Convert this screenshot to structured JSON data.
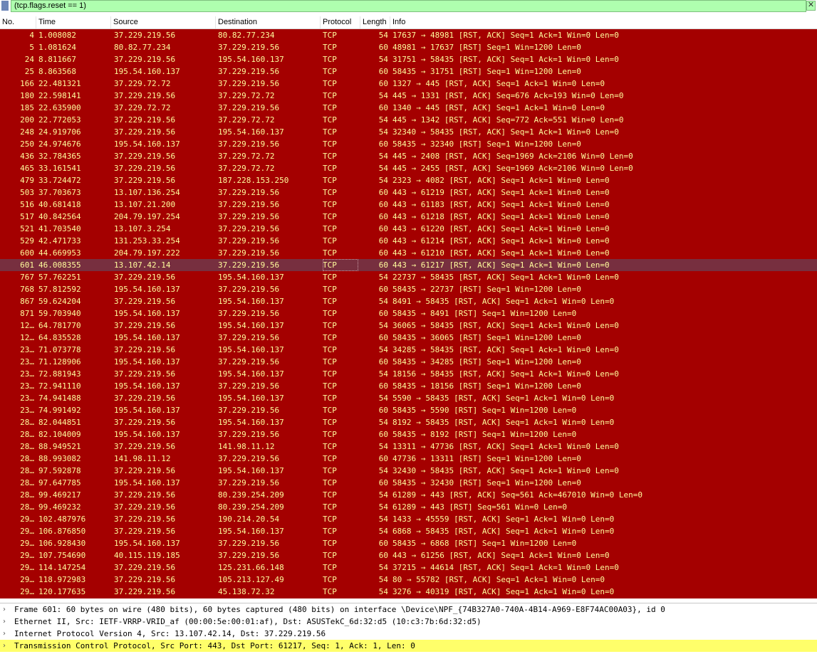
{
  "filter": {
    "value": "(tcp.flags.reset == 1)",
    "close_glyph": "✕"
  },
  "columns": [
    "No.",
    "Time",
    "Source",
    "Destination",
    "Protocol",
    "Length",
    "Info"
  ],
  "colors": {
    "row_bg": "#a40000",
    "row_fg": "#fffc9c",
    "selected_bg": "#772f3f",
    "filter_bg": "#afffaf",
    "highlight_bg": "#ffff6a"
  },
  "selected_no": "601",
  "packets": [
    {
      "no": "4",
      "time": "1.008082",
      "src": "37.229.219.56",
      "dst": "80.82.77.234",
      "proto": "TCP",
      "len": "54",
      "info": "17637 → 48981 [RST, ACK] Seq=1 Ack=1 Win=0 Len=0"
    },
    {
      "no": "5",
      "time": "1.081624",
      "src": "80.82.77.234",
      "dst": "37.229.219.56",
      "proto": "TCP",
      "len": "60",
      "info": "48981 → 17637 [RST] Seq=1 Win=1200 Len=0"
    },
    {
      "no": "24",
      "time": "8.811667",
      "src": "37.229.219.56",
      "dst": "195.54.160.137",
      "proto": "TCP",
      "len": "54",
      "info": "31751 → 58435 [RST, ACK] Seq=1 Ack=1 Win=0 Len=0"
    },
    {
      "no": "25",
      "time": "8.863568",
      "src": "195.54.160.137",
      "dst": "37.229.219.56",
      "proto": "TCP",
      "len": "60",
      "info": "58435 → 31751 [RST] Seq=1 Win=1200 Len=0"
    },
    {
      "no": "166",
      "time": "22.481321",
      "src": "37.229.72.72",
      "dst": "37.229.219.56",
      "proto": "TCP",
      "len": "60",
      "info": "1327 → 445 [RST, ACK] Seq=1 Ack=1 Win=0 Len=0"
    },
    {
      "no": "180",
      "time": "22.598141",
      "src": "37.229.219.56",
      "dst": "37.229.72.72",
      "proto": "TCP",
      "len": "54",
      "info": "445 → 1331 [RST, ACK] Seq=676 Ack=193 Win=0 Len=0"
    },
    {
      "no": "185",
      "time": "22.635900",
      "src": "37.229.72.72",
      "dst": "37.229.219.56",
      "proto": "TCP",
      "len": "60",
      "info": "1340 → 445 [RST, ACK] Seq=1 Ack=1 Win=0 Len=0"
    },
    {
      "no": "200",
      "time": "22.772053",
      "src": "37.229.219.56",
      "dst": "37.229.72.72",
      "proto": "TCP",
      "len": "54",
      "info": "445 → 1342 [RST, ACK] Seq=772 Ack=551 Win=0 Len=0"
    },
    {
      "no": "248",
      "time": "24.919706",
      "src": "37.229.219.56",
      "dst": "195.54.160.137",
      "proto": "TCP",
      "len": "54",
      "info": "32340 → 58435 [RST, ACK] Seq=1 Ack=1 Win=0 Len=0"
    },
    {
      "no": "250",
      "time": "24.974676",
      "src": "195.54.160.137",
      "dst": "37.229.219.56",
      "proto": "TCP",
      "len": "60",
      "info": "58435 → 32340 [RST] Seq=1 Win=1200 Len=0"
    },
    {
      "no": "436",
      "time": "32.784365",
      "src": "37.229.219.56",
      "dst": "37.229.72.72",
      "proto": "TCP",
      "len": "54",
      "info": "445 → 2408 [RST, ACK] Seq=1969 Ack=2106 Win=0 Len=0"
    },
    {
      "no": "465",
      "time": "33.161541",
      "src": "37.229.219.56",
      "dst": "37.229.72.72",
      "proto": "TCP",
      "len": "54",
      "info": "445 → 2455 [RST, ACK] Seq=1969 Ack=2106 Win=0 Len=0"
    },
    {
      "no": "479",
      "time": "33.724472",
      "src": "37.229.219.56",
      "dst": "187.228.153.250",
      "proto": "TCP",
      "len": "54",
      "info": "2323 → 4082 [RST, ACK] Seq=1 Ack=1 Win=0 Len=0"
    },
    {
      "no": "503",
      "time": "37.703673",
      "src": "13.107.136.254",
      "dst": "37.229.219.56",
      "proto": "TCP",
      "len": "60",
      "info": "443 → 61219 [RST, ACK] Seq=1 Ack=1 Win=0 Len=0"
    },
    {
      "no": "516",
      "time": "40.681418",
      "src": "13.107.21.200",
      "dst": "37.229.219.56",
      "proto": "TCP",
      "len": "60",
      "info": "443 → 61183 [RST, ACK] Seq=1 Ack=1 Win=0 Len=0"
    },
    {
      "no": "517",
      "time": "40.842564",
      "src": "204.79.197.254",
      "dst": "37.229.219.56",
      "proto": "TCP",
      "len": "60",
      "info": "443 → 61218 [RST, ACK] Seq=1 Ack=1 Win=0 Len=0"
    },
    {
      "no": "521",
      "time": "41.703540",
      "src": "13.107.3.254",
      "dst": "37.229.219.56",
      "proto": "TCP",
      "len": "60",
      "info": "443 → 61220 [RST, ACK] Seq=1 Ack=1 Win=0 Len=0"
    },
    {
      "no": "529",
      "time": "42.471733",
      "src": "131.253.33.254",
      "dst": "37.229.219.56",
      "proto": "TCP",
      "len": "60",
      "info": "443 → 61214 [RST, ACK] Seq=1 Ack=1 Win=0 Len=0"
    },
    {
      "no": "600",
      "time": "44.669953",
      "src": "204.79.197.222",
      "dst": "37.229.219.56",
      "proto": "TCP",
      "len": "60",
      "info": "443 → 61210 [RST, ACK] Seq=1 Ack=1 Win=0 Len=0"
    },
    {
      "no": "601",
      "time": "46.008355",
      "src": "13.107.42.14",
      "dst": "37.229.219.56",
      "proto": "TCP",
      "len": "60",
      "info": "443 → 61217 [RST, ACK] Seq=1 Ack=1 Win=0 Len=0"
    },
    {
      "no": "767",
      "time": "57.762251",
      "src": "37.229.219.56",
      "dst": "195.54.160.137",
      "proto": "TCP",
      "len": "54",
      "info": "22737 → 58435 [RST, ACK] Seq=1 Ack=1 Win=0 Len=0"
    },
    {
      "no": "768",
      "time": "57.812592",
      "src": "195.54.160.137",
      "dst": "37.229.219.56",
      "proto": "TCP",
      "len": "60",
      "info": "58435 → 22737 [RST] Seq=1 Win=1200 Len=0"
    },
    {
      "no": "867",
      "time": "59.624204",
      "src": "37.229.219.56",
      "dst": "195.54.160.137",
      "proto": "TCP",
      "len": "54",
      "info": "8491 → 58435 [RST, ACK] Seq=1 Ack=1 Win=0 Len=0"
    },
    {
      "no": "871",
      "time": "59.703940",
      "src": "195.54.160.137",
      "dst": "37.229.219.56",
      "proto": "TCP",
      "len": "60",
      "info": "58435 → 8491 [RST] Seq=1 Win=1200 Len=0"
    },
    {
      "no": "12…",
      "time": "64.781770",
      "src": "37.229.219.56",
      "dst": "195.54.160.137",
      "proto": "TCP",
      "len": "54",
      "info": "36065 → 58435 [RST, ACK] Seq=1 Ack=1 Win=0 Len=0"
    },
    {
      "no": "12…",
      "time": "64.835528",
      "src": "195.54.160.137",
      "dst": "37.229.219.56",
      "proto": "TCP",
      "len": "60",
      "info": "58435 → 36065 [RST] Seq=1 Win=1200 Len=0"
    },
    {
      "no": "23…",
      "time": "71.073778",
      "src": "37.229.219.56",
      "dst": "195.54.160.137",
      "proto": "TCP",
      "len": "54",
      "info": "34285 → 58435 [RST, ACK] Seq=1 Ack=1 Win=0 Len=0"
    },
    {
      "no": "23…",
      "time": "71.128906",
      "src": "195.54.160.137",
      "dst": "37.229.219.56",
      "proto": "TCP",
      "len": "60",
      "info": "58435 → 34285 [RST] Seq=1 Win=1200 Len=0"
    },
    {
      "no": "23…",
      "time": "72.881943",
      "src": "37.229.219.56",
      "dst": "195.54.160.137",
      "proto": "TCP",
      "len": "54",
      "info": "18156 → 58435 [RST, ACK] Seq=1 Ack=1 Win=0 Len=0"
    },
    {
      "no": "23…",
      "time": "72.941110",
      "src": "195.54.160.137",
      "dst": "37.229.219.56",
      "proto": "TCP",
      "len": "60",
      "info": "58435 → 18156 [RST] Seq=1 Win=1200 Len=0"
    },
    {
      "no": "23…",
      "time": "74.941488",
      "src": "37.229.219.56",
      "dst": "195.54.160.137",
      "proto": "TCP",
      "len": "54",
      "info": "5590 → 58435 [RST, ACK] Seq=1 Ack=1 Win=0 Len=0"
    },
    {
      "no": "23…",
      "time": "74.991492",
      "src": "195.54.160.137",
      "dst": "37.229.219.56",
      "proto": "TCP",
      "len": "60",
      "info": "58435 → 5590 [RST] Seq=1 Win=1200 Len=0"
    },
    {
      "no": "28…",
      "time": "82.044851",
      "src": "37.229.219.56",
      "dst": "195.54.160.137",
      "proto": "TCP",
      "len": "54",
      "info": "8192 → 58435 [RST, ACK] Seq=1 Ack=1 Win=0 Len=0"
    },
    {
      "no": "28…",
      "time": "82.104009",
      "src": "195.54.160.137",
      "dst": "37.229.219.56",
      "proto": "TCP",
      "len": "60",
      "info": "58435 → 8192 [RST] Seq=1 Win=1200 Len=0"
    },
    {
      "no": "28…",
      "time": "88.949521",
      "src": "37.229.219.56",
      "dst": "141.98.11.12",
      "proto": "TCP",
      "len": "54",
      "info": "13311 → 47736 [RST, ACK] Seq=1 Ack=1 Win=0 Len=0"
    },
    {
      "no": "28…",
      "time": "88.993082",
      "src": "141.98.11.12",
      "dst": "37.229.219.56",
      "proto": "TCP",
      "len": "60",
      "info": "47736 → 13311 [RST] Seq=1 Win=1200 Len=0"
    },
    {
      "no": "28…",
      "time": "97.592878",
      "src": "37.229.219.56",
      "dst": "195.54.160.137",
      "proto": "TCP",
      "len": "54",
      "info": "32430 → 58435 [RST, ACK] Seq=1 Ack=1 Win=0 Len=0"
    },
    {
      "no": "28…",
      "time": "97.647785",
      "src": "195.54.160.137",
      "dst": "37.229.219.56",
      "proto": "TCP",
      "len": "60",
      "info": "58435 → 32430 [RST] Seq=1 Win=1200 Len=0"
    },
    {
      "no": "28…",
      "time": "99.469217",
      "src": "37.229.219.56",
      "dst": "80.239.254.209",
      "proto": "TCP",
      "len": "54",
      "info": "61289 → 443 [RST, ACK] Seq=561 Ack=467010 Win=0 Len=0"
    },
    {
      "no": "28…",
      "time": "99.469232",
      "src": "37.229.219.56",
      "dst": "80.239.254.209",
      "proto": "TCP",
      "len": "54",
      "info": "61289 → 443 [RST] Seq=561 Win=0 Len=0"
    },
    {
      "no": "29…",
      "time": "102.487976",
      "src": "37.229.219.56",
      "dst": "190.214.20.54",
      "proto": "TCP",
      "len": "54",
      "info": "1433 → 45559 [RST, ACK] Seq=1 Ack=1 Win=0 Len=0"
    },
    {
      "no": "29…",
      "time": "106.876850",
      "src": "37.229.219.56",
      "dst": "195.54.160.137",
      "proto": "TCP",
      "len": "54",
      "info": "6868 → 58435 [RST, ACK] Seq=1 Ack=1 Win=0 Len=0"
    },
    {
      "no": "29…",
      "time": "106.928430",
      "src": "195.54.160.137",
      "dst": "37.229.219.56",
      "proto": "TCP",
      "len": "60",
      "info": "58435 → 6868 [RST] Seq=1 Win=1200 Len=0"
    },
    {
      "no": "29…",
      "time": "107.754690",
      "src": "40.115.119.185",
      "dst": "37.229.219.56",
      "proto": "TCP",
      "len": "60",
      "info": "443 → 61256 [RST, ACK] Seq=1 Ack=1 Win=0 Len=0"
    },
    {
      "no": "29…",
      "time": "114.147254",
      "src": "37.229.219.56",
      "dst": "125.231.66.148",
      "proto": "TCP",
      "len": "54",
      "info": "37215 → 44614 [RST, ACK] Seq=1 Ack=1 Win=0 Len=0"
    },
    {
      "no": "29…",
      "time": "118.972983",
      "src": "37.229.219.56",
      "dst": "105.213.127.49",
      "proto": "TCP",
      "len": "54",
      "info": "80 → 55782 [RST, ACK] Seq=1 Ack=1 Win=0 Len=0"
    },
    {
      "no": "29…",
      "time": "120.177635",
      "src": "37.229.219.56",
      "dst": "45.138.72.32",
      "proto": "TCP",
      "len": "54",
      "info": "3276 → 40319 [RST, ACK] Seq=1 Ack=1 Win=0 Len=0"
    }
  ],
  "details": [
    {
      "text": "Frame 601: 60 bytes on wire (480 bits), 60 bytes captured (480 bits) on interface \\Device\\NPF_{74B327A0-740A-4B14-A969-E8F74AC00A03}, id 0",
      "highlight": false
    },
    {
      "text": "Ethernet II, Src: IETF-VRRP-VRID_af (00:00:5e:00:01:af), Dst: ASUSTekC_6d:32:d5 (10:c3:7b:6d:32:d5)",
      "highlight": false
    },
    {
      "text": "Internet Protocol Version 4, Src: 13.107.42.14, Dst: 37.229.219.56",
      "highlight": false
    },
    {
      "text": "Transmission Control Protocol, Src Port: 443, Dst Port: 61217, Seq: 1, Ack: 1, Len: 0",
      "highlight": true
    }
  ],
  "expand_glyph": "›"
}
